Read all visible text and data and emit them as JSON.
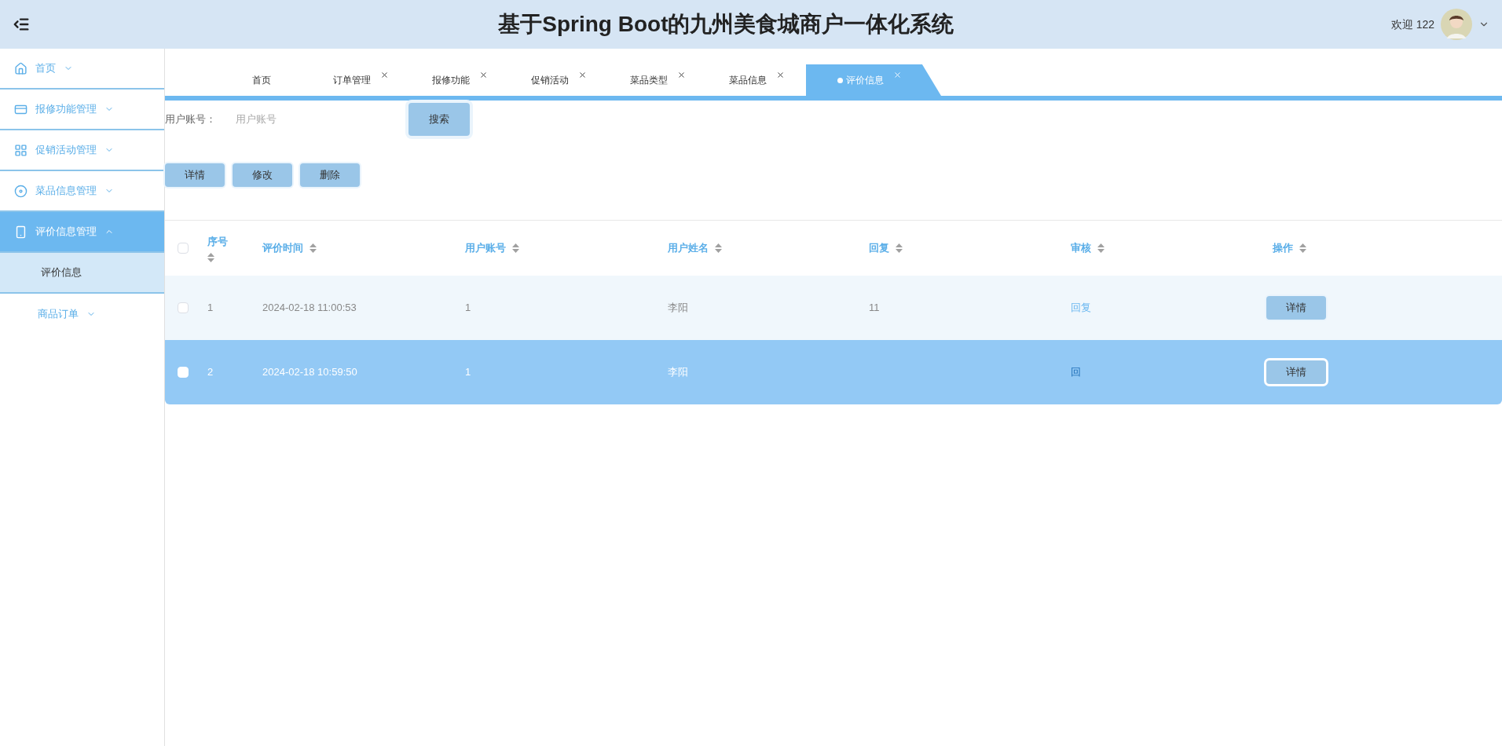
{
  "header": {
    "title": "基于Spring Boot的九州美食城商户一体化系统",
    "welcome": "欢迎 122"
  },
  "sidebar": {
    "items": [
      {
        "label": "首页",
        "kind": "icon",
        "selected": false,
        "expanded": false
      },
      {
        "label": "报修功能管理",
        "kind": "icon",
        "selected": false,
        "expanded": false
      },
      {
        "label": "促销活动管理",
        "kind": "icon",
        "selected": false,
        "expanded": false
      },
      {
        "label": "菜品信息管理",
        "kind": "icon",
        "selected": false,
        "expanded": false
      },
      {
        "label": "评价信息管理",
        "kind": "icon",
        "selected": true,
        "expanded": true,
        "children": [
          {
            "label": "评价信息",
            "selected": true
          }
        ]
      },
      {
        "label": "商品订单",
        "kind": "plain",
        "selected": false,
        "expanded": false
      }
    ]
  },
  "tabs": [
    {
      "label": "首页",
      "closable": false,
      "selected": false
    },
    {
      "label": "订单管理",
      "closable": true,
      "selected": false
    },
    {
      "label": "报修功能",
      "closable": true,
      "selected": false
    },
    {
      "label": "促销活动",
      "closable": true,
      "selected": false
    },
    {
      "label": "菜品类型",
      "closable": true,
      "selected": false
    },
    {
      "label": "菜品信息",
      "closable": true,
      "selected": false
    },
    {
      "label": "评价信息",
      "closable": true,
      "selected": true
    }
  ],
  "search": {
    "label": "用户账号：",
    "placeholder": "用户账号",
    "button": "搜索"
  },
  "actions": [
    "详情",
    "修改",
    "删除"
  ],
  "table": {
    "all_checked": false,
    "columns": [
      "序号",
      "评价时间",
      "用户账号",
      "用户姓名",
      "回复",
      "审核",
      "操作"
    ],
    "rows": [
      {
        "selected": false,
        "checked": false,
        "cells": [
          "1",
          "2024-02-18 11:00:53",
          "1",
          "李阳",
          "11"
        ],
        "review": "回复",
        "action": "详情"
      },
      {
        "selected": true,
        "checked": false,
        "cells": [
          "2",
          "2024-02-18 10:59:50",
          "1",
          "李阳",
          ""
        ],
        "review": "回",
        "action": "详情"
      }
    ]
  }
}
